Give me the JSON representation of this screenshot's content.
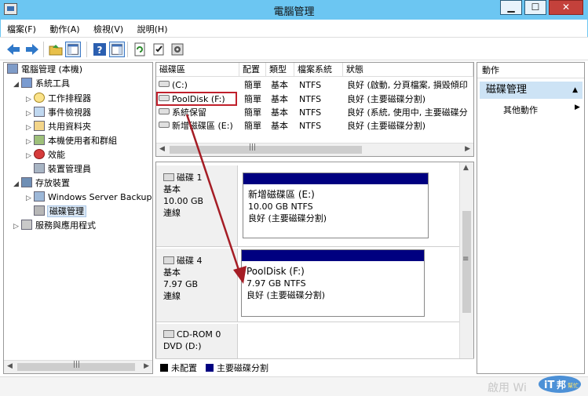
{
  "window": {
    "title": "電腦管理",
    "minimize_label": "▁",
    "maximize_label": "☐",
    "close_label": "✕"
  },
  "menu": [
    "檔案(F)",
    "動作(A)",
    "檢視(V)",
    "說明(H)"
  ],
  "tree": {
    "root": "電腦管理 (本機)",
    "system_tools": "系統工具",
    "task_scheduler": "工作排程器",
    "event_viewer": "事件檢視器",
    "shared_folders": "共用資料夾",
    "local_users": "本機使用者和群組",
    "performance": "效能",
    "device_manager": "裝置管理員",
    "storage": "存放裝置",
    "windows_backup": "Windows Server Backup",
    "disk_management": "磁碟管理",
    "services": "服務與應用程式"
  },
  "volumes": {
    "headers": [
      "磁碟區",
      "配置",
      "類型",
      "檔案系統",
      "狀態"
    ],
    "rows": [
      {
        "name": "(C:)",
        "layout": "簡單",
        "type": "基本",
        "fs": "NTFS",
        "status": "良好 (啟動, 分頁檔案, 損毀傾印"
      },
      {
        "name": "PoolDisk (F:)",
        "layout": "簡單",
        "type": "基本",
        "fs": "NTFS",
        "status": "良好 (主要磁碟分割)"
      },
      {
        "name": "系統保留",
        "layout": "簡單",
        "type": "基本",
        "fs": "NTFS",
        "status": "良好 (系統, 使用中, 主要磁碟分"
      },
      {
        "name": "新增磁碟區 (E:)",
        "layout": "簡單",
        "type": "基本",
        "fs": "NTFS",
        "status": "良好 (主要磁碟分割)"
      }
    ]
  },
  "disks": [
    {
      "name": "磁碟 1",
      "type": "基本",
      "size": "10.00 GB",
      "state": "連線",
      "partition": {
        "name": "新增磁碟區 (E:)",
        "size": "10.00 GB NTFS",
        "status": "良好 (主要磁碟分割)"
      }
    },
    {
      "name": "磁碟 4",
      "type": "基本",
      "size": "7.97 GB",
      "state": "連線",
      "partition": {
        "name": "PoolDisk (F:)",
        "size": "7.97 GB NTFS",
        "status": "良好 (主要磁碟分割)"
      }
    },
    {
      "name": "CD-ROM 0",
      "type": "DVD (D:)"
    }
  ],
  "legend": [
    {
      "label": "未配置",
      "color": "#000000"
    },
    {
      "label": "主要磁碟分割",
      "color": "#000080"
    }
  ],
  "actions": {
    "header": "動作",
    "selected": "磁碟管理",
    "more": "其他動作"
  },
  "watermark": "啟用 Wi",
  "logo": {
    "it": "iT",
    "bang": "邦",
    "help": "幫忙"
  },
  "colors": {
    "titlebar": "#6cc6f2",
    "partition_band": "#000080",
    "highlight_box": "#c0202c",
    "annotation_arrow": "#a51d25"
  }
}
